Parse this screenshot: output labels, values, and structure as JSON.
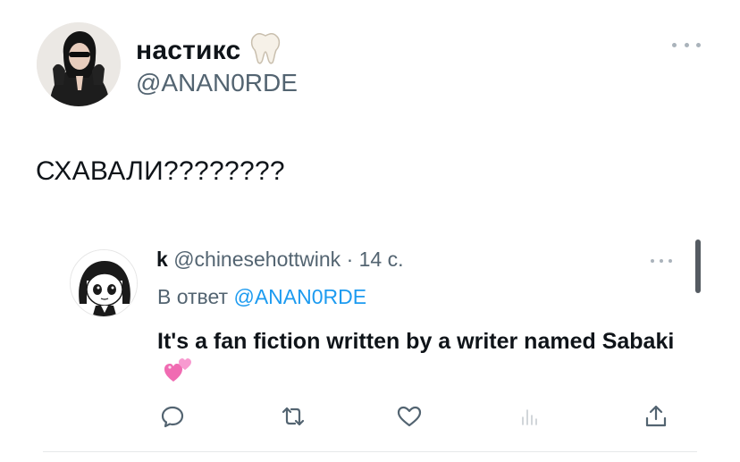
{
  "main_tweet": {
    "author_name": "настикс",
    "author_handle": "@ANAN0RDE",
    "text": "СХАВАЛИ????????",
    "avatar_icon": "profile-photo-icon",
    "emoji_icon": "tooth-icon"
  },
  "reply": {
    "author_name": "k",
    "author_handle": "@chinesehottwink",
    "separator": "·",
    "time": "14 с.",
    "replying_prefix": "В ответ",
    "replying_to": "@ANAN0RDE",
    "text": "It's a fan fiction written by a writer named Sabaki",
    "emoji_icon": "two-hearts-icon",
    "avatar_icon": "anime-avatar-icon"
  },
  "actions": [
    "reply-icon",
    "retweet-icon",
    "like-icon",
    "views-icon",
    "share-icon"
  ],
  "colors": {
    "text": "#0f1419",
    "secondary": "#536471",
    "link": "#1d9bf0",
    "heart": "#f06bb2"
  }
}
